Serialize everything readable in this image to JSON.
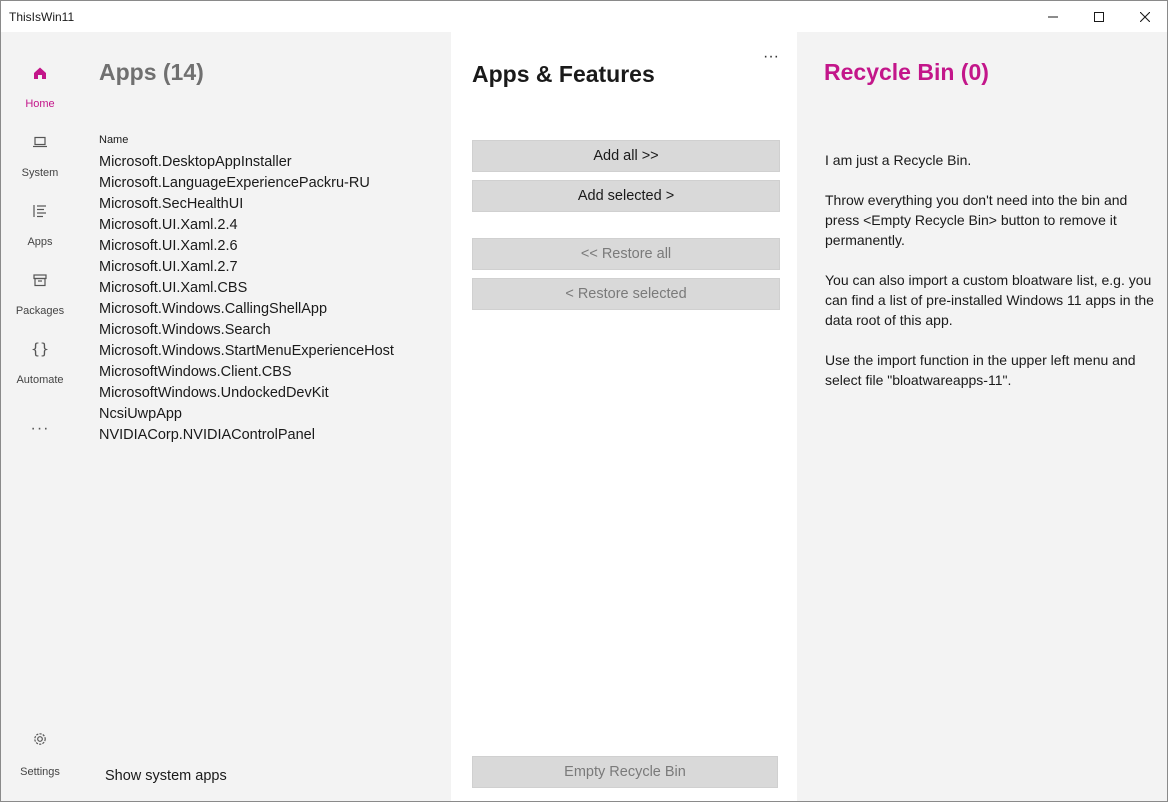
{
  "window": {
    "title": "ThisIsWin11",
    "controls": [
      "minimize-icon",
      "maximize-icon",
      "close-icon"
    ]
  },
  "sidebar": {
    "items": [
      {
        "label": "Home",
        "icon": "home-icon",
        "active": true
      },
      {
        "label": "System",
        "icon": "laptop-icon",
        "active": false
      },
      {
        "label": "Apps",
        "icon": "list-icon",
        "active": false
      },
      {
        "label": "Packages",
        "icon": "package-icon",
        "active": false
      },
      {
        "label": "Automate",
        "icon": "braces-icon",
        "active": false
      }
    ],
    "more": "···",
    "settings_label": "Settings"
  },
  "apps_panel": {
    "title": "Apps (14)",
    "column_header": "Name",
    "apps": [
      "Microsoft.DesktopAppInstaller",
      "Microsoft.LanguageExperiencePackru-RU",
      "Microsoft.SecHealthUI",
      "Microsoft.UI.Xaml.2.4",
      "Microsoft.UI.Xaml.2.6",
      "Microsoft.UI.Xaml.2.7",
      "Microsoft.UI.Xaml.CBS",
      "Microsoft.Windows.CallingShellApp",
      "Microsoft.Windows.Search",
      "Microsoft.Windows.StartMenuExperienceHost",
      "MicrosoftWindows.Client.CBS",
      "MicrosoftWindows.UndockedDevKit",
      "NcsiUwpApp",
      "NVIDIACorp.NVIDIAControlPanel"
    ],
    "show_system_apps": "Show system apps"
  },
  "center_panel": {
    "title": "Apps & Features",
    "more": "···",
    "add_all": "Add all >>",
    "add_selected": "Add selected >",
    "restore_all": "<< Restore all",
    "restore_selected": "< Restore selected",
    "empty_bin": "Empty Recycle Bin"
  },
  "bin_panel": {
    "title": "Recycle Bin (0)",
    "paragraphs": [
      "I am just a Recycle Bin.",
      "Throw everything you don't need into the bin and press <Empty Recycle Bin> button to remove it permanently.",
      "You can also import a custom bloatware list, e.g. you can find a list of pre-installed Windows 11 apps in the data root of this app.",
      "Use the import function in the upper left menu and select file \"bloatwareapps-11\"."
    ]
  },
  "colors": {
    "accent": "#c3168a",
    "panel_bg": "#f3f3f3",
    "center_bg": "#ffffff",
    "button_bg": "#d9d9d9"
  }
}
